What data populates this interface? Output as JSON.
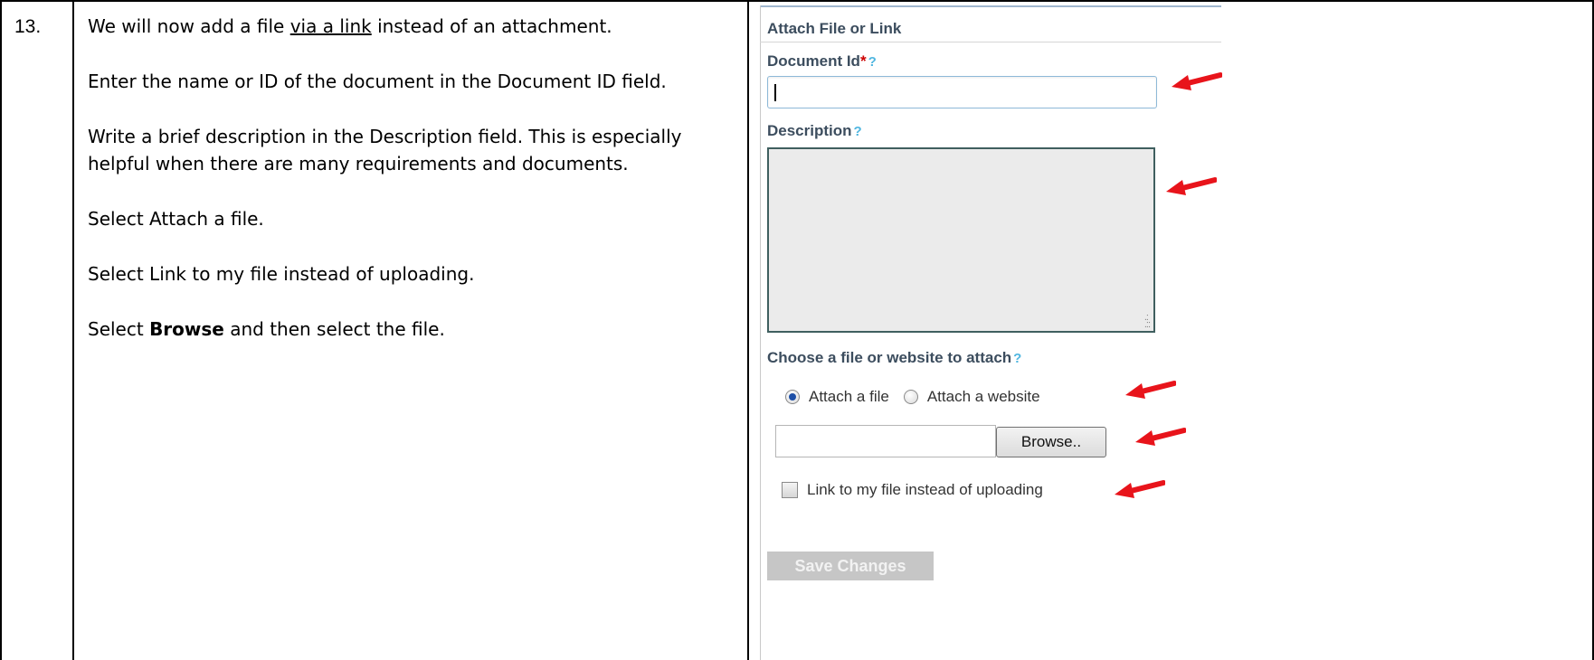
{
  "step": {
    "number": "13."
  },
  "instructions": {
    "line1_prefix": "We will now add a file ",
    "line1_link": "via a link",
    "line1_suffix": " instead of an attachment.",
    "line2": "Enter the name or ID of the document in the Document ID field.",
    "line3a": "Write a brief description in the Description field.  This is especially",
    "line3b": "helpful when there are many requirements and documents.",
    "line4": "Select Attach a file.",
    "line5": "Select Link to my file instead of uploading.",
    "line6_prefix": "Select ",
    "line6_bold": "Browse",
    "line6_suffix": " and then select the file."
  },
  "form": {
    "title": "Attach File or Link",
    "document_id_label": "Document Id",
    "required_mark": "*",
    "help_mark": "?",
    "document_id_value": "",
    "description_label": "Description",
    "description_value": "",
    "attach_label": "Choose a file or website to attach",
    "radio_attach_file": "Attach a file",
    "radio_attach_website": "Attach a website",
    "radio_selected": "Attach a file",
    "browse_label": "Browse..",
    "link_checkbox_label": "Link to my file instead of uploading",
    "link_checkbox_checked": false,
    "save_label": "Save Changes"
  },
  "colors": {
    "arrow": "#e8141b",
    "label": "#3c4d5e",
    "help": "#4fb6e0",
    "required": "#cc0000"
  }
}
